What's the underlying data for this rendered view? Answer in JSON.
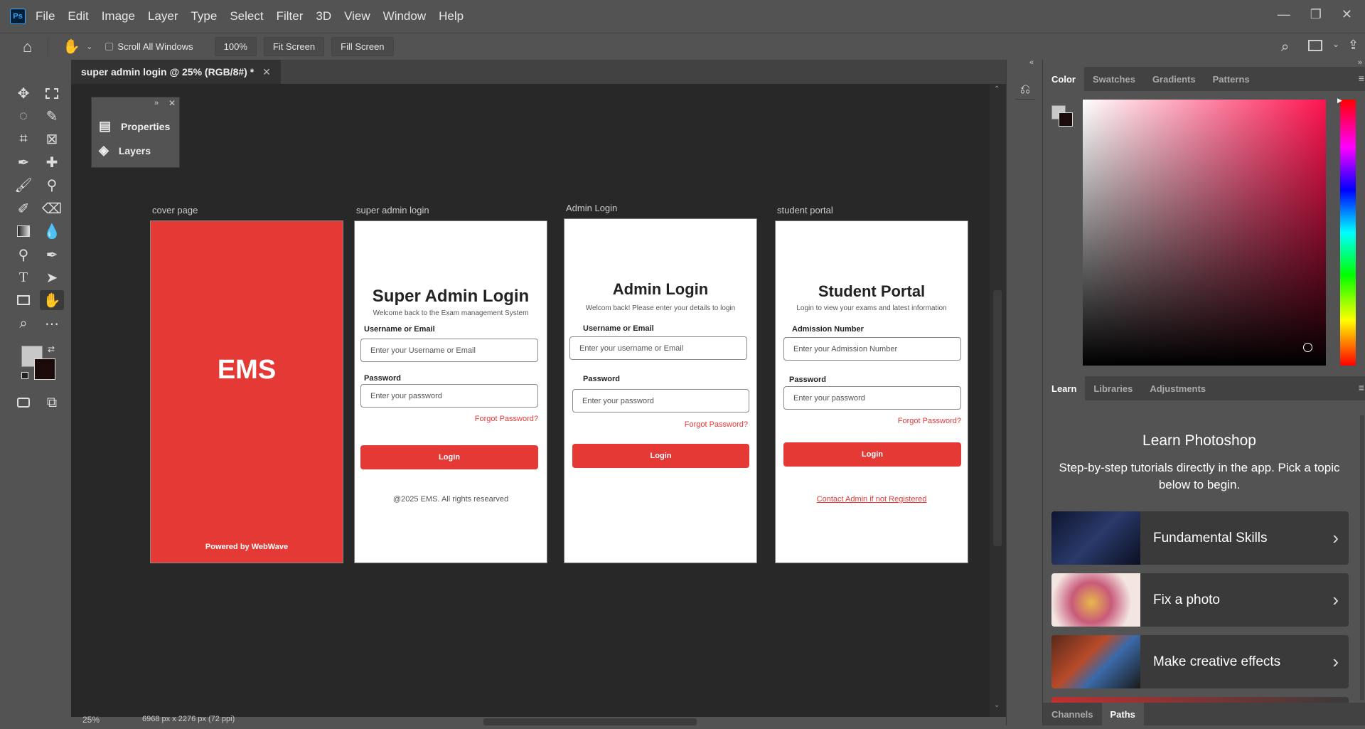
{
  "menu": [
    "File",
    "Edit",
    "Image",
    "Layer",
    "Type",
    "Select",
    "Filter",
    "3D",
    "View",
    "Window",
    "Help"
  ],
  "app_logo": "Ps",
  "options": {
    "scroll_all_label": "Scroll All Windows",
    "zoom_value": "100%",
    "fit_screen": "Fit Screen",
    "fill_screen": "Fill Screen"
  },
  "doc": {
    "tab_title": "super admin login @ 25% (RGB/8#) *",
    "zoom": "25%",
    "dimensions": "6968 px x 2276 px (72 ppi)"
  },
  "float_panel": {
    "properties": "Properties",
    "layers": "Layers"
  },
  "artboards": {
    "cover": {
      "label": "cover page",
      "title": "EMS",
      "footer": "Powered by WebWave",
      "color": "#e53935"
    },
    "super": {
      "label": "super admin login",
      "title": "Super Admin Login",
      "subtitle": "Welcome back to the Exam management System",
      "field1_label": "Username or Email",
      "field1_placeholder": "Enter your Username or Email",
      "field2_label": "Password",
      "field2_placeholder": "Enter your password",
      "forgot": "Forgot Password?",
      "button": "Login",
      "footer": "@2025 EMS. All rights researved"
    },
    "admin": {
      "label": "Admin Login",
      "title": "Admin Login",
      "subtitle": "Welcom back! Please enter your details to login",
      "field1_label": "Username or Email",
      "field1_placeholder": "Enter  your username or Email",
      "field2_label": "Password",
      "field2_placeholder": "Enter your password",
      "forgot": "Forgot Password?",
      "button": "Login"
    },
    "student": {
      "label": "student portal",
      "title": "Student Portal",
      "subtitle": "Login to view your exams and latest information",
      "field1_label": "Admission Number",
      "field1_placeholder": "Enter your Admission Number",
      "field2_label": "Password",
      "field2_placeholder": "Enter your password",
      "forgot": "Forgot Password?",
      "button": "Login",
      "footer": "Contact Admin if not Registered"
    }
  },
  "color_panel": {
    "tabs": [
      "Color",
      "Swatches",
      "Gradients",
      "Patterns"
    ]
  },
  "learn_panel": {
    "tabs": [
      "Learn",
      "Libraries",
      "Adjustments"
    ],
    "title": "Learn Photoshop",
    "subtitle": "Step-by-step tutorials directly in the app. Pick a topic below to begin.",
    "items": [
      {
        "label": "Fundamental Skills"
      },
      {
        "label": "Fix a photo"
      },
      {
        "label": "Make creative effects"
      }
    ]
  },
  "bottom_panel": {
    "tabs": [
      "Channels",
      "Paths"
    ]
  }
}
